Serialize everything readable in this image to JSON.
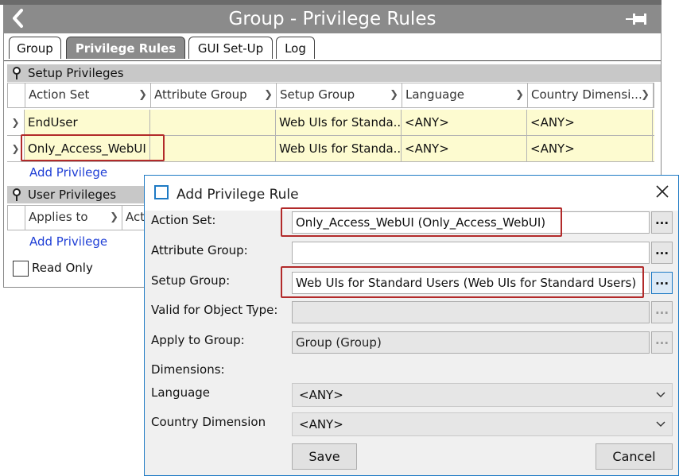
{
  "window": {
    "title": "Group - Privilege Rules"
  },
  "tabs": [
    {
      "label": "Group"
    },
    {
      "label": "Privilege Rules"
    },
    {
      "label": "GUI Set-Up"
    },
    {
      "label": "Log"
    }
  ],
  "setup_privileges": {
    "header": "Setup Privileges",
    "columns": [
      "Action Set",
      "Attribute Group",
      "Setup Group",
      "Language",
      "Country Dimensi..."
    ],
    "rows": [
      [
        "EndUser",
        "",
        "Web UIs for Standa...",
        "<ANY>",
        "<ANY>"
      ],
      [
        "Only_Access_WebUI",
        "",
        "Web UIs for Standa...",
        "<ANY>",
        "<ANY>"
      ]
    ],
    "add_link": "Add Privilege"
  },
  "user_privileges": {
    "header": "User Privileges",
    "columns": [
      "Applies to",
      "Acti"
    ],
    "add_link": "Add Privilege"
  },
  "read_only": {
    "label": "Read Only",
    "checked": false
  },
  "dialog": {
    "title": "Add Privilege Rule",
    "action_set": {
      "label": "Action Set:",
      "value": "Only_Access_WebUI (Only_Access_WebUI)",
      "button": "..."
    },
    "attribute_group": {
      "label": "Attribute Group:",
      "value": "",
      "button": "..."
    },
    "setup_group": {
      "label": "Setup Group:",
      "value": "Web UIs for Standard Users (Web UIs for Standard Users)",
      "button": "..."
    },
    "valid_for_object_type": {
      "label": "Valid for Object Type:",
      "value": "",
      "button": "..."
    },
    "apply_to_group": {
      "label": "Apply to Group:",
      "value": "Group (Group)",
      "button": "..."
    },
    "dimensions_label": "Dimensions:",
    "language": {
      "label": "Language",
      "value": "<ANY>"
    },
    "country_dimension": {
      "label": "Country Dimension",
      "value": "<ANY>"
    },
    "save": "Save",
    "cancel": "Cancel"
  },
  "colors": {
    "highlight_box": "#b22a2a",
    "dialog_accent": "#1e7ac4",
    "title_gray": "#8b8b8b",
    "row_yellow": "#fdfbd0",
    "link_blue": "#1f3fd6"
  }
}
